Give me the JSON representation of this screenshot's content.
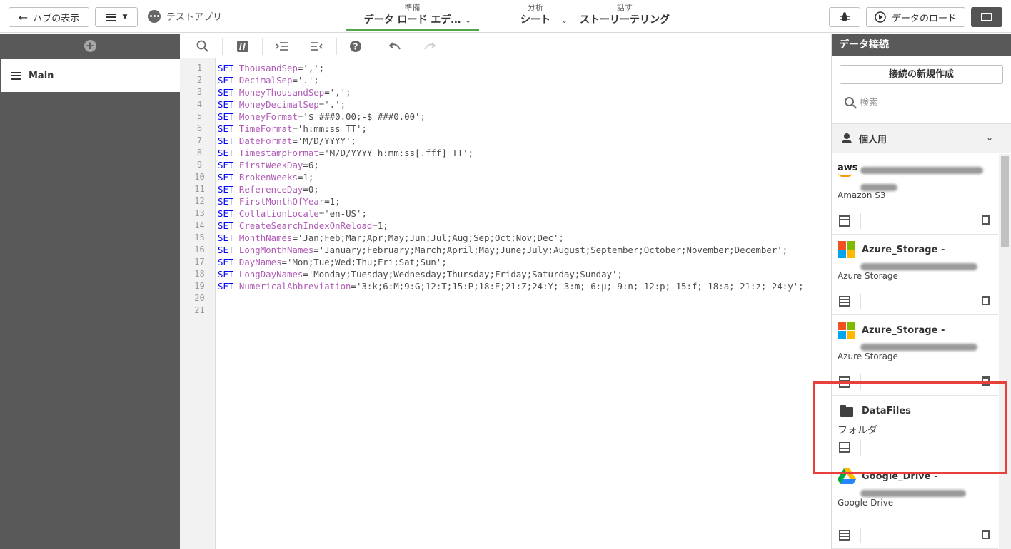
{
  "topbar": {
    "hub_label": "ハブの表示",
    "app_name": "テストアプリ",
    "tabs": [
      {
        "small": "準備",
        "big": "データ ロード エデ…",
        "active": true
      },
      {
        "small": "分析",
        "big": "シート",
        "active": false
      },
      {
        "small": "話す",
        "big": "ストーリーテリング",
        "active": false
      }
    ],
    "load_label": "データのロード"
  },
  "left_panel": {
    "section": "Main"
  },
  "editor": {
    "line_numbers": [
      "1",
      "2",
      "3",
      "4",
      "5",
      "6",
      "7",
      "8",
      "9",
      "10",
      "11",
      "12",
      "13",
      "14",
      "15",
      "16",
      "17",
      "18",
      "19",
      "20",
      "21"
    ],
    "lines": [
      {
        "kw": "SET",
        "var": "ThousandSep",
        "val": "=',';"
      },
      {
        "kw": "SET",
        "var": "DecimalSep",
        "val": "='.';"
      },
      {
        "kw": "SET",
        "var": "MoneyThousandSep",
        "val": "=',';"
      },
      {
        "kw": "SET",
        "var": "MoneyDecimalSep",
        "val": "='.';"
      },
      {
        "kw": "SET",
        "var": "MoneyFormat",
        "val": "='$ ###0.00;-$ ###0.00';"
      },
      {
        "kw": "SET",
        "var": "TimeFormat",
        "val": "='h:mm:ss TT';"
      },
      {
        "kw": "SET",
        "var": "DateFormat",
        "val": "='M/D/YYYY';"
      },
      {
        "kw": "SET",
        "var": "TimestampFormat",
        "val": "='M/D/YYYY h:mm:ss[.fff] TT';"
      },
      {
        "kw": "SET",
        "var": "FirstWeekDay",
        "val": "=6;"
      },
      {
        "kw": "SET",
        "var": "BrokenWeeks",
        "val": "=1;"
      },
      {
        "kw": "SET",
        "var": "ReferenceDay",
        "val": "=0;"
      },
      {
        "kw": "SET",
        "var": "FirstMonthOfYear",
        "val": "=1;"
      },
      {
        "kw": "SET",
        "var": "CollationLocale",
        "val": "='en-US';"
      },
      {
        "kw": "SET",
        "var": "CreateSearchIndexOnReload",
        "val": "=1;"
      },
      {
        "kw": "SET",
        "var": "MonthNames",
        "val": "='Jan;Feb;Mar;Apr;May;Jun;Jul;Aug;Sep;Oct;Nov;Dec';"
      },
      {
        "kw": "SET",
        "var": "LongMonthNames",
        "val": "='January;February;March;April;May;June;July;August;September;October;November;December';"
      },
      {
        "kw": "SET",
        "var": "DayNames",
        "val": "='Mon;Tue;Wed;Thu;Fri;Sat;Sun';"
      },
      {
        "kw": "SET",
        "var": "LongDayNames",
        "val": "='Monday;Tuesday;Wednesday;Thursday;Friday;Saturday;Sunday';"
      },
      {
        "kw": "SET",
        "var": "NumericalAbbreviation",
        "val": "='3:k;6:M;9:G;12:T;15:P;18:E;21:Z;24:Y;-3:m;-6:μ;-9:n;-12:p;-15:f;-18:a;-21:z;-24:y';"
      },
      {
        "kw": "",
        "var": "",
        "val": ""
      },
      {
        "kw": "",
        "var": "",
        "val": ""
      }
    ]
  },
  "right_panel": {
    "title": "データ接続",
    "new_connection": "接続の新規作成",
    "search_placeholder": "検索",
    "space_label": "個人用",
    "connections": [
      {
        "logo": "aws",
        "name": "",
        "type": "Amazon S3",
        "trash": true
      },
      {
        "logo": "microsoft",
        "name": "Azure_Storage -",
        "type": "Azure Storage",
        "trash": true
      },
      {
        "logo": "microsoft",
        "name": "Azure_Storage -",
        "type": "Azure Storage",
        "trash": true
      },
      {
        "logo": "folder",
        "name": "DataFiles",
        "type": "フォルダ",
        "trash": false
      },
      {
        "logo": "google-drive",
        "name": "Google_Drive -",
        "type": "Google Drive",
        "trash": true
      }
    ],
    "highlight_color": "#e8403a"
  }
}
